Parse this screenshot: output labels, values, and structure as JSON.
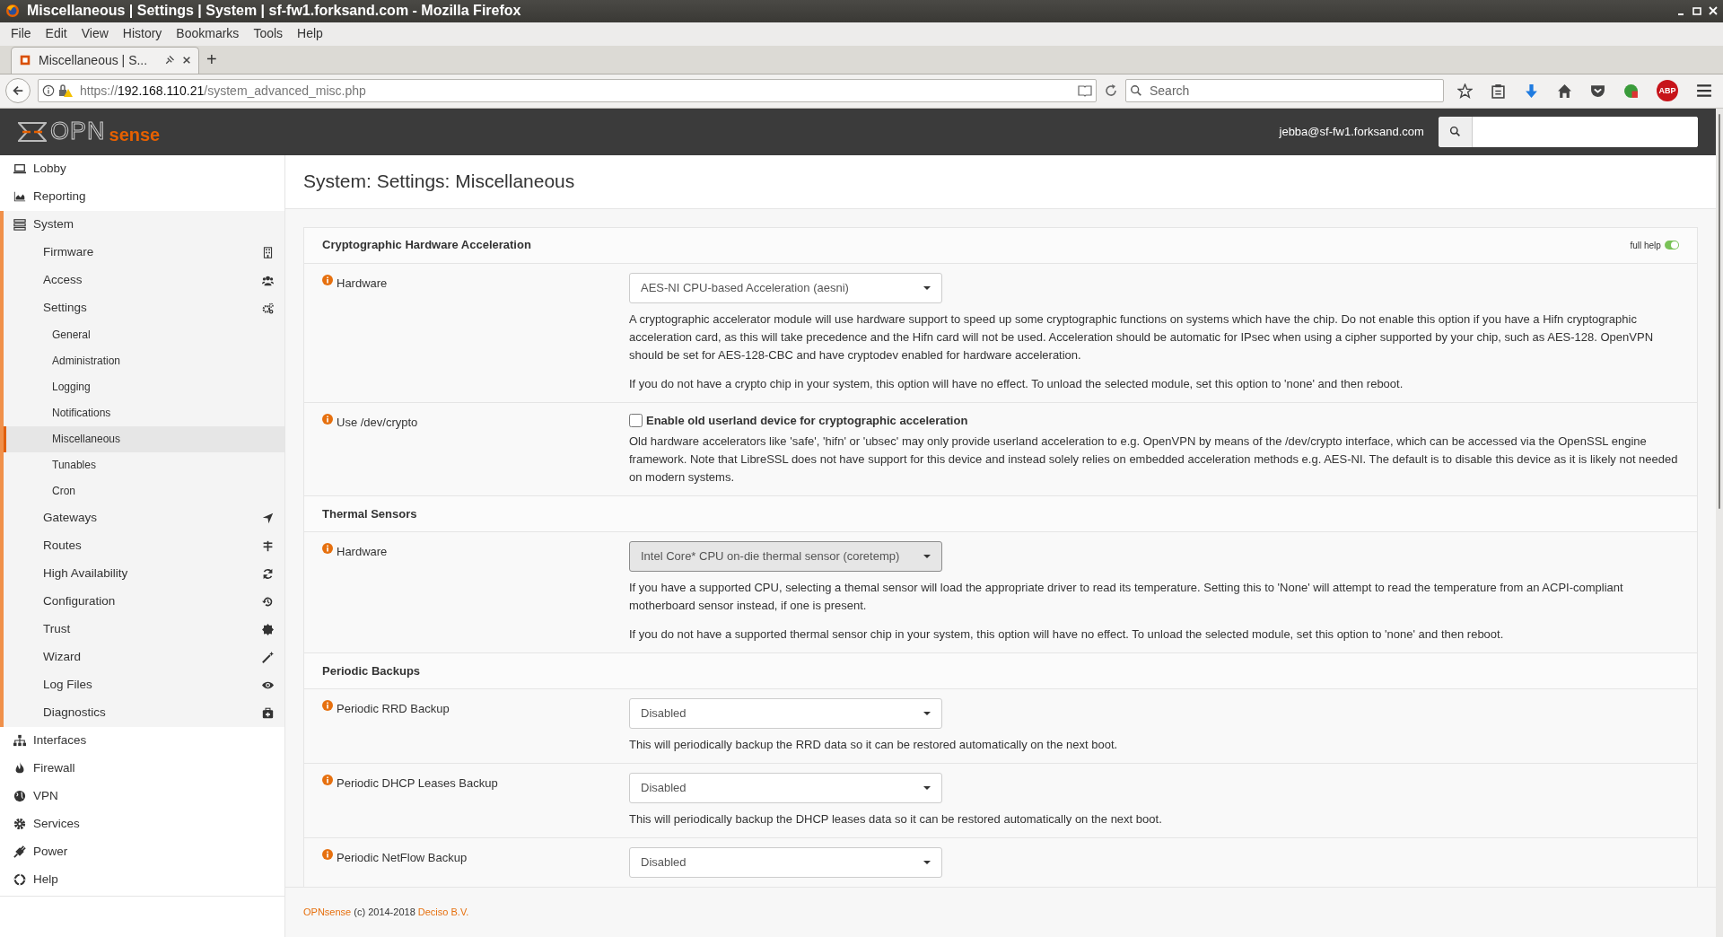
{
  "browser": {
    "window_title": "Miscellaneous | Settings | System | sf-fw1.forksand.com - Mozilla Firefox",
    "menu": [
      "File",
      "Edit",
      "View",
      "History",
      "Bookmarks",
      "Tools",
      "Help"
    ],
    "tab": {
      "title": "Miscellaneous | S...",
      "selected": true
    },
    "new_tab": "+",
    "url": {
      "scheme": "https://",
      "host": "192.168.110.21",
      "path": "/system_advanced_misc.php"
    },
    "search": {
      "placeholder": "Search"
    },
    "abp_badge": "ABP"
  },
  "header": {
    "logo": {
      "part1": "OPN",
      "part2": "sense"
    },
    "user": "jebba@sf-fw1.forksand.com"
  },
  "sidebar": [
    {
      "label": "Lobby",
      "selected": false,
      "expanded": false
    },
    {
      "label": "Reporting",
      "selected": false,
      "expanded": false
    },
    {
      "label": "System",
      "selected": false,
      "expanded": true,
      "children": [
        {
          "label": "Firmware",
          "selected": false,
          "expanded": false
        },
        {
          "label": "Access",
          "selected": false,
          "expanded": false
        },
        {
          "label": "Settings",
          "selected": false,
          "expanded": true,
          "children": [
            {
              "label": "General",
              "selected": false
            },
            {
              "label": "Administration",
              "selected": false
            },
            {
              "label": "Logging",
              "selected": false
            },
            {
              "label": "Notifications",
              "selected": false
            },
            {
              "label": "Miscellaneous",
              "selected": true
            },
            {
              "label": "Tunables",
              "selected": false
            },
            {
              "label": "Cron",
              "selected": false
            }
          ]
        },
        {
          "label": "Gateways",
          "selected": false,
          "expanded": false
        },
        {
          "label": "Routes",
          "selected": false,
          "expanded": false
        },
        {
          "label": "High Availability",
          "selected": false,
          "expanded": false
        },
        {
          "label": "Configuration",
          "selected": false,
          "expanded": false
        },
        {
          "label": "Trust",
          "selected": false,
          "expanded": false
        },
        {
          "label": "Wizard",
          "selected": false,
          "expanded": false
        },
        {
          "label": "Log Files",
          "selected": false,
          "expanded": false
        },
        {
          "label": "Diagnostics",
          "selected": false,
          "expanded": false
        }
      ]
    },
    {
      "label": "Interfaces",
      "selected": false,
      "expanded": false
    },
    {
      "label": "Firewall",
      "selected": false,
      "expanded": false
    },
    {
      "label": "VPN",
      "selected": false,
      "expanded": false
    },
    {
      "label": "Services",
      "selected": false,
      "expanded": false
    },
    {
      "label": "Power",
      "selected": false,
      "expanded": false
    },
    {
      "label": "Help",
      "selected": false,
      "expanded": false
    }
  ],
  "page_title": "System: Settings: Miscellaneous",
  "sections": [
    {
      "title": "Cryptographic Hardware Acceleration",
      "full_help": {
        "label": "full help",
        "on": true
      },
      "rows": [
        {
          "label": "Hardware",
          "kind": "select",
          "value": "AES-NI CPU-based Acceleration (aesni)",
          "focused": false,
          "help": [
            "A cryptographic accelerator module will use hardware support to speed up some cryptographic functions on systems which have the chip. Do not enable this option if you have a Hifn cryptographic acceleration card, as this will take precedence and the Hifn card will not be used. Acceleration should be automatic for IPsec when using a cipher supported by your chip, such as AES-128. OpenVPN should be set for AES-128-CBC and have cryptodev enabled for hardware acceleration.",
            "If you do not have a crypto chip in your system, this option will have no effect. To unload the selected module, set this option to 'none' and then reboot."
          ]
        },
        {
          "label": "Use /dev/crypto",
          "kind": "checkbox",
          "value": "Enable old userland device for cryptographic acceleration",
          "checked": false,
          "help": [
            "Old hardware accelerators like 'safe', 'hifn' or 'ubsec' may only provide userland acceleration to e.g. OpenVPN by means of the /dev/crypto interface, which can be accessed via the OpenSSL engine framework. Note that LibreSSL does not have support for this device and instead solely relies on embedded acceleration methods e.g. AES-NI. The default is to disable this device as it is likely not needed on modern systems."
          ]
        }
      ]
    },
    {
      "title": "Thermal Sensors",
      "rows": [
        {
          "label": "Hardware",
          "kind": "select",
          "value": "Intel Core* CPU on-die thermal sensor (coretemp)",
          "focused": true,
          "help": [
            "If you have a supported CPU, selecting a themal sensor will load the appropriate driver to read its temperature. Setting this to 'None' will attempt to read the temperature from an ACPI-compliant motherboard sensor instead, if one is present.",
            "If you do not have a supported thermal sensor chip in your system, this option will have no effect. To unload the selected module, set this option to 'none' and then reboot."
          ]
        }
      ]
    },
    {
      "title": "Periodic Backups",
      "rows": [
        {
          "label": "Periodic RRD Backup",
          "kind": "select",
          "value": "Disabled",
          "focused": false,
          "help": [
            "This will periodically backup the RRD data so it can be restored automatically on the next boot."
          ]
        },
        {
          "label": "Periodic DHCP Leases Backup",
          "kind": "select",
          "value": "Disabled",
          "focused": false,
          "help": [
            "This will periodically backup the DHCP leases data so it can be restored automatically on the next boot."
          ]
        },
        {
          "label": "Periodic NetFlow Backup",
          "kind": "select",
          "value": "Disabled",
          "focused": false
        }
      ]
    }
  ],
  "footer": {
    "brand_link": "OPNsense",
    "text": "(c) 2014-2018",
    "company_link": "Deciso B.V."
  }
}
